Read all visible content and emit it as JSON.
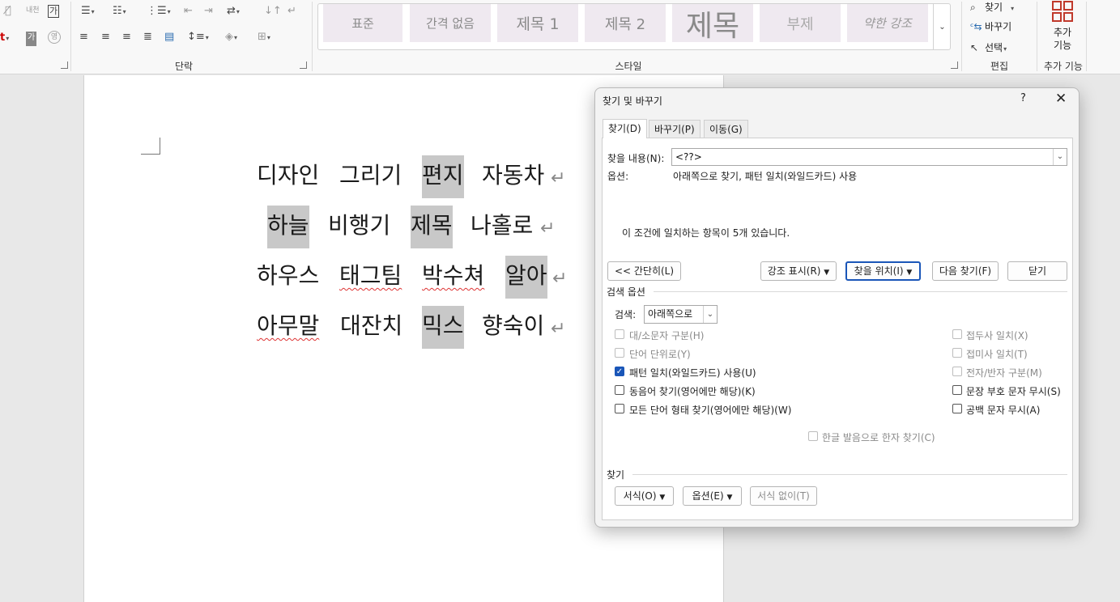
{
  "ribbon": {
    "paragraph_group_label": "단락",
    "styles_group_label": "스타일",
    "editing_group_label": "편집",
    "addins_group_label": "추가 기능",
    "styles": [
      "표준",
      "간격 없음",
      "제목 1",
      "제목 2",
      "제목",
      "부제",
      "약한 강조"
    ],
    "editing": {
      "find": "찾기",
      "replace": "바꾸기",
      "select": "선택"
    },
    "addins_button": "추가\n기능",
    "font_toolbar": {
      "han_glyph": "가",
      "phonetic_glyph": "가",
      "box_glyph": "가"
    }
  },
  "document": {
    "lines": [
      [
        "디자인",
        "그리기",
        "편지",
        "자동차"
      ],
      [
        "하늘",
        "비행기",
        "제목",
        "나홀로"
      ],
      [
        "하우스",
        "태그팀",
        "박수쳐",
        "알아"
      ],
      [
        "아무말",
        "대잔치",
        "믹스",
        "향숙이"
      ]
    ],
    "pilcrow": "↵"
  },
  "dialog": {
    "title": "찾기 및 바꾸기",
    "help": "?",
    "tabs": [
      "찾기(D)",
      "바꾸기(P)",
      "이동(G)"
    ],
    "find_label": "찾을 내용(N):",
    "find_value": "<??>",
    "options_label": "옵션:",
    "options_value": "아래쪽으로 찾기, 패턴 일치(와일드카드) 사용",
    "match_message": "이 조건에 일치하는 항목이 5개 있습니다.",
    "buttons": {
      "less": "<< 간단히(L)",
      "highlight": "강조 표시(R)",
      "find_in": "찾을 위치(I)",
      "find_next": "다음 찾기(F)",
      "close": "닫기"
    },
    "search_options_header": "검색 옵션",
    "search_label": "검색:",
    "search_direction": "아래쪽으로",
    "checkboxes_left": [
      {
        "label": "대/소문자 구분(H)",
        "checked": false,
        "enabled": false
      },
      {
        "label": "단어 단위로(Y)",
        "checked": false,
        "enabled": false
      },
      {
        "label": "패턴 일치(와일드카드) 사용(U)",
        "checked": true,
        "enabled": true
      },
      {
        "label": "동음어 찾기(영어에만 해당)(K)",
        "checked": false,
        "enabled": true
      },
      {
        "label": "모든 단어 형태 찾기(영어에만 해당)(W)",
        "checked": false,
        "enabled": true
      }
    ],
    "checkboxes_right": [
      {
        "label": "접두사 일치(X)",
        "checked": false,
        "enabled": false
      },
      {
        "label": "접미사 일치(T)",
        "checked": false,
        "enabled": false
      },
      {
        "label": "전자/반자 구분(M)",
        "checked": false,
        "enabled": false
      },
      {
        "label": "문장 부호 문자 무시(S)",
        "checked": false,
        "enabled": true
      },
      {
        "label": "공백 문자 무시(A)",
        "checked": false,
        "enabled": true
      }
    ],
    "hanja_option": "한글 발음으로 한자 찾기(C)",
    "find_section_label": "찾기",
    "bottom_buttons": {
      "format": "서식(O)",
      "special": "옵션(E)",
      "no_format": "서식 없이(T)"
    }
  }
}
